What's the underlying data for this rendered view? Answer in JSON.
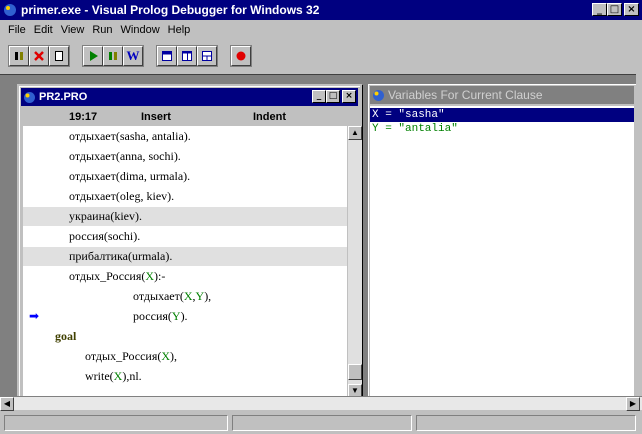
{
  "window": {
    "title": "primer.exe - Visual Prolog Debugger for Windows 32",
    "min": "_",
    "max": "□",
    "close": "×"
  },
  "menu": [
    "File",
    "Edit",
    "View",
    "Run",
    "Window",
    "Help"
  ],
  "toolbar": {
    "groups": [
      [
        "pause-icon",
        "stop-icon",
        "new-icon"
      ],
      [
        "run-icon",
        "step-icon",
        "watch-icon"
      ],
      [
        "tile-icon",
        "cascade-icon",
        "arrange-icon"
      ],
      [
        "breakpoint-icon"
      ]
    ],
    "w_label": "W"
  },
  "editor": {
    "title": "PR2.PRO",
    "time": "19:17",
    "mode": "Insert",
    "indent": "Indent",
    "lines": [
      {
        "parts": [
          [
            "отдыхает(sasha, antalia).",
            ""
          ]
        ],
        "indent": 1,
        "hl": false
      },
      {
        "parts": [
          [
            "отдыхает(anna, sochi).",
            ""
          ]
        ],
        "indent": 1,
        "hl": false
      },
      {
        "parts": [
          [
            "отдыхает(dima, urmala).",
            ""
          ]
        ],
        "indent": 1,
        "hl": false
      },
      {
        "parts": [
          [
            "отдыхает(oleg, kiev).",
            ""
          ]
        ],
        "indent": 1,
        "hl": false
      },
      {
        "parts": [
          [
            "украина(kiev).",
            ""
          ]
        ],
        "indent": 1,
        "hl": true
      },
      {
        "parts": [
          [
            "россия(sochi).",
            ""
          ]
        ],
        "indent": 1,
        "hl": false
      },
      {
        "parts": [
          [
            "прибалтика(urmala).",
            ""
          ]
        ],
        "indent": 1,
        "hl": true
      },
      {
        "parts": [
          [
            "отдых_Россия(",
            ""
          ],
          [
            "X",
            "var"
          ],
          [
            "):-",
            ""
          ]
        ],
        "indent": 1,
        "hl": false
      },
      {
        "parts": [
          [
            "отдыхает(",
            ""
          ],
          [
            "X",
            "var"
          ],
          [
            ",",
            ""
          ],
          [
            "Y",
            "var"
          ],
          [
            "),",
            ""
          ]
        ],
        "indent": 3,
        "hl": false
      },
      {
        "parts": [
          [
            "россия(",
            ""
          ],
          [
            "Y",
            "var"
          ],
          [
            ").",
            ""
          ]
        ],
        "indent": 3,
        "hl": false,
        "arrow": true
      },
      {
        "parts": [
          [
            "goal",
            "kw"
          ]
        ],
        "indent": 0,
        "hl": false
      },
      {
        "parts": [
          [
            "отдых_Россия(",
            ""
          ],
          [
            "X",
            "var"
          ],
          [
            "),",
            ""
          ]
        ],
        "indent": 2,
        "hl": false
      },
      {
        "parts": [
          [
            "write(",
            ""
          ],
          [
            "X",
            "var"
          ],
          [
            "),nl.",
            ""
          ]
        ],
        "indent": 2,
        "hl": false
      }
    ],
    "arrow_glyph": "➡"
  },
  "variables": {
    "title": "Variables For Current Clause",
    "rows": [
      "X = \"sasha\"",
      "Y = \"antalia\""
    ]
  },
  "colors": {
    "titlebar_active": "#000080",
    "titlebar_inactive": "#808080",
    "variable": "#008000",
    "breakpoint": "#e00000"
  }
}
